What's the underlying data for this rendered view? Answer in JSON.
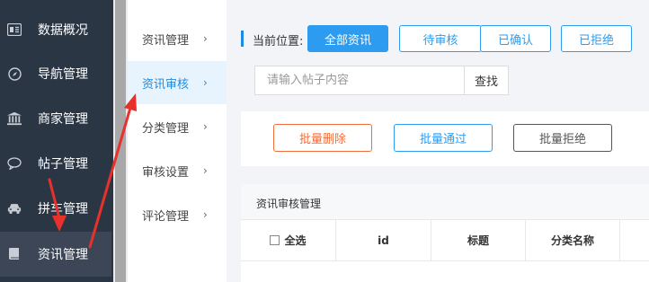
{
  "sidebar": {
    "items": [
      {
        "label": "数据概况",
        "icon": "dashboard-icon"
      },
      {
        "label": "导航管理",
        "icon": "compass-icon"
      },
      {
        "label": "商家管理",
        "icon": "bank-icon"
      },
      {
        "label": "帖子管理",
        "icon": "comment-icon"
      },
      {
        "label": "拼车管理",
        "icon": "car-icon"
      },
      {
        "label": "资讯管理",
        "icon": "book-icon"
      }
    ]
  },
  "submenu": {
    "items": [
      {
        "label": "资讯管理"
      },
      {
        "label": "资讯审核"
      },
      {
        "label": "分类管理"
      },
      {
        "label": "审核设置"
      },
      {
        "label": "评论管理"
      }
    ]
  },
  "filter": {
    "label": "当前位置:",
    "buttons": [
      "全部资讯",
      "待审核",
      "已确认",
      "已拒绝"
    ]
  },
  "search": {
    "placeholder": "请输入帖子内容",
    "button": "查找"
  },
  "actions": {
    "delete": "批量删除",
    "approve": "批量通过",
    "reject": "批量拒绝"
  },
  "table": {
    "title": "资讯审核管理",
    "select_all": "全选",
    "columns": [
      "id",
      "标题",
      "分类名称"
    ]
  },
  "colors": {
    "sidebar_bg": "#2b3644",
    "accent": "#2d9cf0",
    "delete": "#f06e3c",
    "approve": "#2d9cf0",
    "reject": "#555555",
    "annotation": "#e8312a"
  }
}
